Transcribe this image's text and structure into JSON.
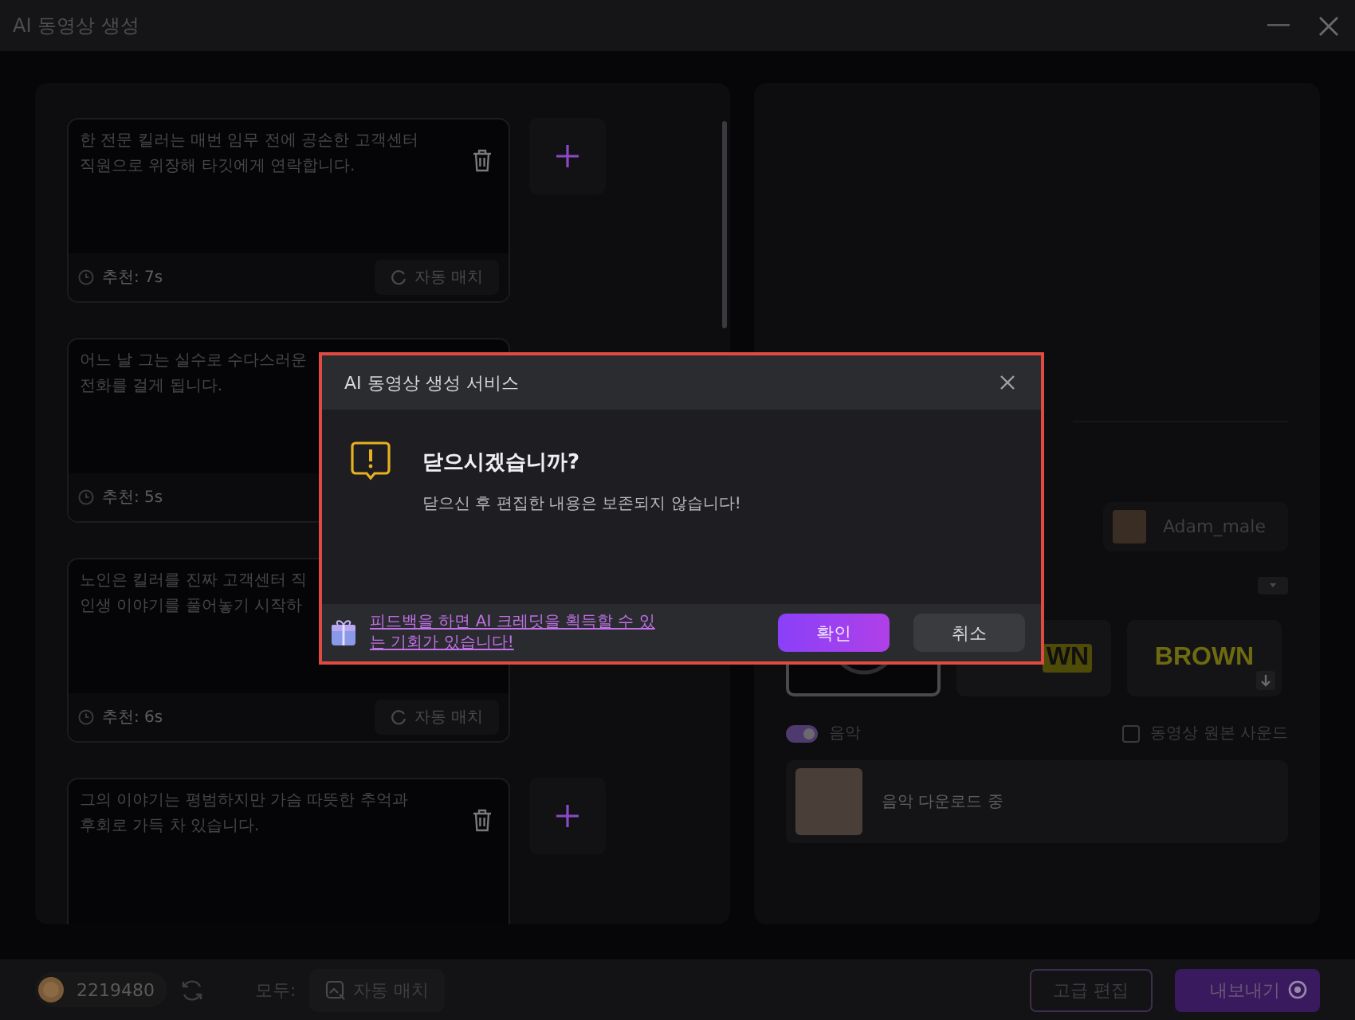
{
  "window": {
    "title": "AI 동영상 생성"
  },
  "scenes": [
    {
      "text": "한 전문 킬러는 매번 임무 전에 공손한 고객센터\n직원으로 위장해 타깃에게 연락합니다.",
      "deletable": true,
      "add": true,
      "footer": {
        "recommend": "추천: 7s",
        "match": "자동 매치"
      }
    },
    {
      "text": "어느 날 그는 실수로 수다스러운\n전화를 걸게 됩니다.",
      "footer": {
        "recommend": "추천: 5s"
      }
    },
    {
      "text": "노인은 킬러를 진짜 고객센터 직\n인생 이야기를 풀어놓기 시작하",
      "footer": {
        "recommend": "추천: 6s",
        "match": "자동 매치"
      }
    },
    {
      "text": "그의 이야기는 평범하지만 가슴 따뜻한 추억과\n후회로 가득 차 있습니다.",
      "deletable": true,
      "add": true
    }
  ],
  "voice": {
    "name": "Adam_male"
  },
  "styles": [
    {
      "kind": "none",
      "selected": true
    },
    {
      "kind": "text",
      "label": "WN",
      "selected": false
    },
    {
      "kind": "text",
      "label": "BROWN",
      "selected": false,
      "download": true
    }
  ],
  "music": {
    "label": "음악",
    "on": true,
    "track": "음악 다운로드 중"
  },
  "original_sound": {
    "label": "동영상 원본 사운드",
    "checked": false
  },
  "bottom_bar": {
    "credits": "2219480",
    "all_label": "모두:",
    "auto_match": "자동 매치",
    "advanced": "고급 편집",
    "export": "내보내기"
  },
  "dialog": {
    "title": "AI 동영상 생성 서비스",
    "heading": "닫으시겠습니까?",
    "message": "닫으신 후 편집한 내용은 보존되지 않습니다!",
    "feedback_link": "피드백을 하면 AI 크레딧을 획득할 수 있는 기회가 있습니다!",
    "confirm": "확인",
    "cancel": "취소"
  }
}
